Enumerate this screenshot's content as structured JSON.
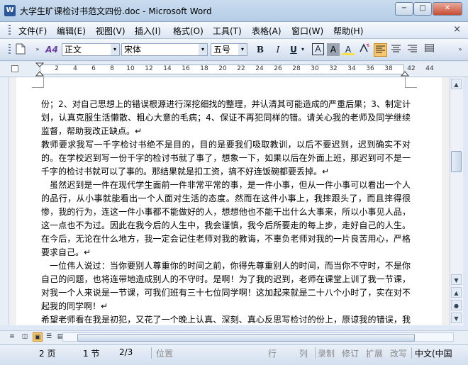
{
  "window": {
    "title": "大学生旷课检讨书范文四份.doc - Microsoft Word",
    "app_icon": "W",
    "min_label": "−",
    "max_label": "□",
    "close_label": "✕"
  },
  "menu": {
    "items": [
      "文件(F)",
      "编辑(E)",
      "视图(V)",
      "插入(I)",
      "格式(O)",
      "工具(T)",
      "表格(A)",
      "窗口(W)",
      "帮助(H)"
    ],
    "close_label": "×"
  },
  "toolbar": {
    "style_value": "正文",
    "font_value": "宋体",
    "size_value": "五号",
    "style_icon": "A4",
    "bold": "B",
    "italic": "I",
    "underline": "U",
    "char_border": "A",
    "char_shading": "A",
    "highlight": "A",
    "arrow": "▾"
  },
  "ruler": {
    "numbers": [
      "2",
      "4",
      "6",
      "8",
      "10",
      "12",
      "14",
      "16",
      "18",
      "20",
      "22",
      "24",
      "26",
      "28",
      "30",
      "32",
      "34",
      "36",
      "38",
      "42",
      "44"
    ]
  },
  "document": {
    "paragraphs": [
      "份；2、对自己思想上的错误根源进行深挖细找的整理，并认清其可能造成的严重后果；3、制定计划，认真克服生活懒散、粗心大意的毛病；4、保证不再犯同样的错。请关心我的老师及同学继续监督，帮助我改正缺点。↵",
      "教师要求我写一千字检讨书绝不是目的，目的是要我们吸取教训，以后不要迟到，迟到确实不对的。在学校迟到写一份千字的检讨书就了事了，想象一下，如果以后在外面上班，那迟到可不是一千字的检讨书就可以了事的。那结果就是扣工资，搞不好连饭碗都要丢掉。↵",
      "虽然迟到是一件在现代学生面前一件非常平常的事，是一件小事，但从一件小事可以看出一个人的品行，从小事就能看出一个人面对生活的态度。然而在这件小事上，我摔跟头了，而且摔得很惨，我的行为，连这一件小事都不能做好的人，想想他也不能干出什么大事来，所以小事见人品，这一点也不为过。因此在我今后的人生中，我会谨慎，我今后所要走的每上步，走好自己的人生。在今后，无论在什么地方，我一定会记住老师对我的教诲，不辜负老师对我的一片良苦用心，严格要求自己。↵",
      "一位伟人说过：当你要别人尊重你的时间之前，你得先尊重别人的时间，而当你不守时，不是你自己的问题，也将连带地造成别人的不守时。是啊！为了我的迟到，老师在课堂上训了我一节课，对我一个人来说是一节课，可我们班有三十七位同学啊！这加起来就是二十八个小时了，实在对不起我的同学啊！↵",
      "希望老师看在我是初犯，又花了一个晚上认真、深刻、真心反思写检讨的份上，原谅我的错误，我知道错了，给我个机会改正吧！↵"
    ]
  },
  "status": {
    "page": "2 页",
    "section": "1 节",
    "pages": "2/3",
    "position": "位置",
    "line": "行",
    "column": "列",
    "rec": "录制",
    "trk": "修订",
    "ext": "扩展",
    "ovr": "改写",
    "language": "中文(中国"
  }
}
